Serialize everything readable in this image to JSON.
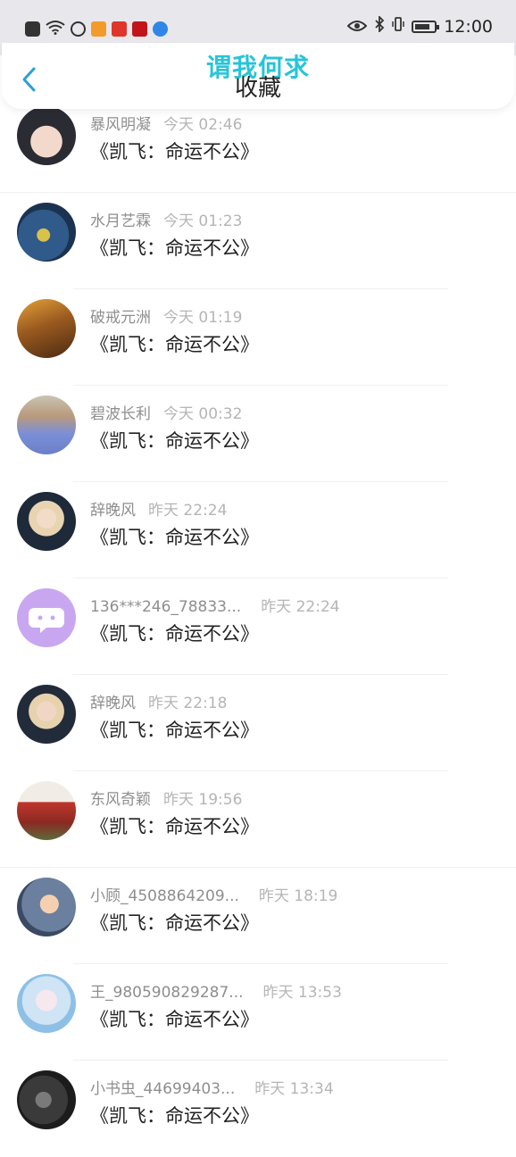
{
  "status_bar": {
    "time": "12:00",
    "notification_icons": [
      "alert-icon",
      "wifi-icon",
      "k-app-icon",
      "play-app-icon",
      "red-app-icon",
      "music-app-icon",
      "blue-app-icon"
    ],
    "system_icons": [
      "eye-icon",
      "bluetooth-icon",
      "vibrate-icon",
      "battery-icon"
    ]
  },
  "header": {
    "title": "收藏",
    "watermark": "谓我何求"
  },
  "items": [
    {
      "name": "暴风明凝",
      "time": "今天 02:46",
      "work": "《凯飞：命运不公》"
    },
    {
      "name": "水月艺霖",
      "time": "今天 01:23",
      "work": "《凯飞：命运不公》"
    },
    {
      "name": "破戒元洲",
      "time": "今天 01:19",
      "work": "《凯飞：命运不公》"
    },
    {
      "name": "碧波长利",
      "time": "今天 00:32",
      "work": "《凯飞：命运不公》"
    },
    {
      "name": "辞晚风",
      "time": "昨天 22:24",
      "work": "《凯飞：命运不公》"
    },
    {
      "name": "136***246_78833...",
      "time": "昨天 22:24",
      "work": "《凯飞：命运不公》"
    },
    {
      "name": "辞晚风",
      "time": "昨天 22:18",
      "work": "《凯飞：命运不公》"
    },
    {
      "name": "东风奇颖",
      "time": "昨天 19:56",
      "work": "《凯飞：命运不公》"
    },
    {
      "name": "小顾_4508864209...",
      "time": "昨天 18:19",
      "work": "《凯飞：命运不公》"
    },
    {
      "name": "王_980590829287...",
      "time": "昨天 13:53",
      "work": "《凯飞：命运不公》"
    },
    {
      "name": "小书虫_44699403...",
      "time": "昨天 13:34",
      "work": "《凯飞：命运不公》"
    }
  ],
  "colors": {
    "accent": "#2a9fd6",
    "watermark": "#28c4d9",
    "status_bar_bg": "#e8e8ec",
    "default_avatar_bg": "#c9a7f0"
  }
}
